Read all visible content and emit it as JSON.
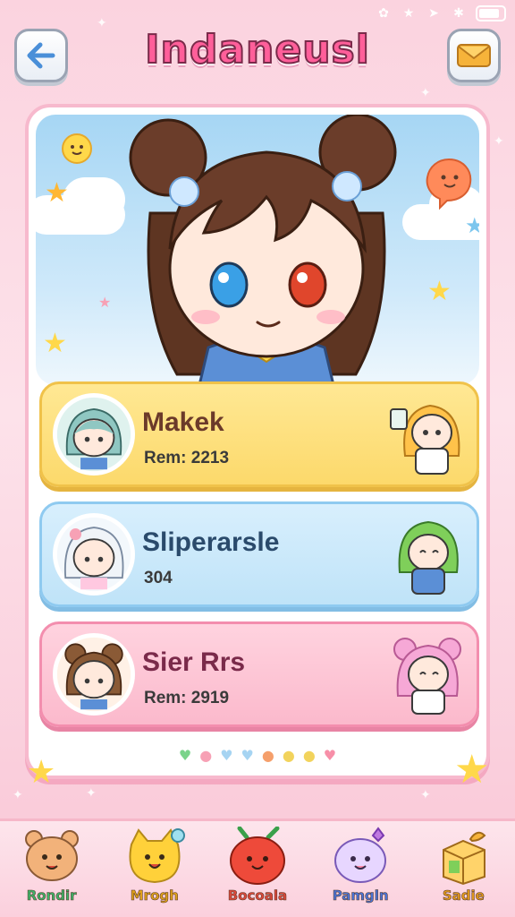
{
  "app": {
    "title": "Indaneusl"
  },
  "header": {
    "back_icon": "arrow-left-icon",
    "mail_icon": "mail-envelope-icon"
  },
  "status_bar": {
    "icons": [
      "notification-icon",
      "star-icon",
      "location-icon",
      "bluetooth-icon",
      "battery-icon"
    ]
  },
  "characters": [
    {
      "name": "Makek",
      "subtitle": "Rem: 2213",
      "theme": "#fcd96b"
    },
    {
      "name": "Sliperarsle",
      "subtitle": "304",
      "theme": "#bfe3f8"
    },
    {
      "name": "Sier Rrs",
      "subtitle": "Rem: 2919",
      "theme": "#fbb9cc"
    }
  ],
  "page_dots": [
    "#7ad38a",
    "#f7a1b5",
    "#a6d4f2",
    "#a6d4f2",
    "#f59f6b",
    "#f2d35c",
    "#f2d35c",
    "#f78fa8"
  ],
  "bottom_nav": [
    {
      "label": "Rondir",
      "color": "#3db56a",
      "icon": "bear-icon"
    },
    {
      "label": "Mrogh",
      "color": "#e0a21a",
      "icon": "yellow-cat-icon"
    },
    {
      "label": "Bocoala",
      "color": "#e0483a",
      "icon": "red-blob-icon"
    },
    {
      "label": "Pamgln",
      "color": "#4a74d8",
      "icon": "purple-bunny-icon"
    },
    {
      "label": "Sadie",
      "color": "#e39a1c",
      "icon": "gift-box-icon"
    }
  ]
}
